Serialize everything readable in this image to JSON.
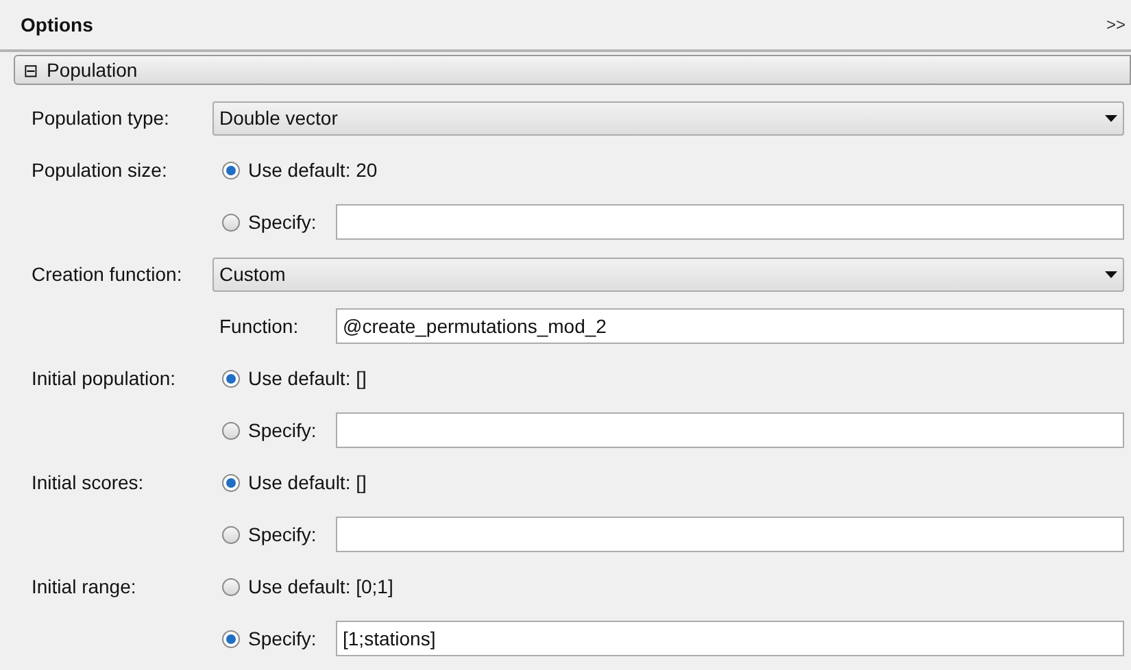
{
  "header": {
    "title": "Options",
    "expand": ">>"
  },
  "section": {
    "toggle": "⊟",
    "title": "Population",
    "expanded": true
  },
  "rows": [
    {
      "kind": "dropdown",
      "label": "Population type:",
      "value": "Double vector"
    },
    {
      "kind": "radio",
      "label": "Population size:",
      "text": "Use default: 20",
      "selected": true
    },
    {
      "kind": "radio_input",
      "text": "Specify:",
      "selected": false
    },
    {
      "kind": "dropdown",
      "label": "Creation function:",
      "value": "Custom"
    },
    {
      "kind": "field",
      "text": "Function:",
      "value": "@create_permutations_mod_2"
    },
    {
      "kind": "radio",
      "label": "Initial population:",
      "text": "Use default: []",
      "selected": true
    },
    {
      "kind": "radio_input",
      "text": "Specify:",
      "selected": false
    },
    {
      "kind": "radio",
      "label": "Initial scores:",
      "text": "Use default: []",
      "selected": true
    },
    {
      "kind": "radio_input",
      "text": "Specify:",
      "selected": false
    },
    {
      "kind": "radio",
      "label": "Initial range:",
      "text": "Use default: [0;1]",
      "selected": false
    },
    {
      "kind": "radio_input",
      "text": "Specify:",
      "selected": true,
      "value": "[1;stations]"
    }
  ]
}
